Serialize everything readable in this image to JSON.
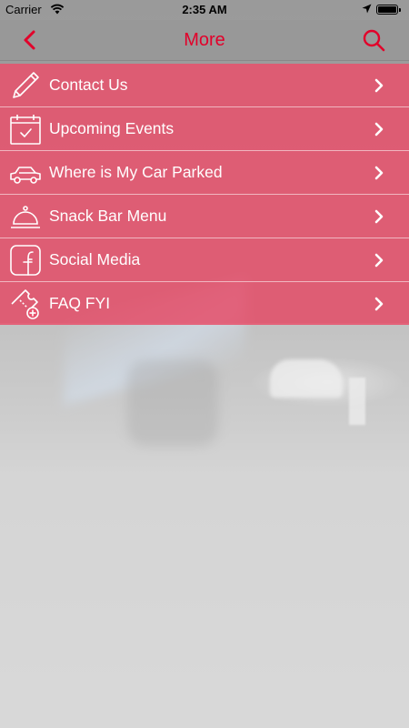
{
  "status_bar": {
    "carrier": "Carrier",
    "time": "2:35 AM"
  },
  "nav": {
    "title": "More",
    "back_icon": "chevron-left-icon",
    "search_icon": "search-icon",
    "accent_color": "#e2002a"
  },
  "menu": {
    "background_color": "#e8526c",
    "items": [
      {
        "label": "Contact Us",
        "icon": "pencil-icon"
      },
      {
        "label": "Upcoming Events",
        "icon": "calendar-check-icon"
      },
      {
        "label": "Where is My Car Parked",
        "icon": "car-icon"
      },
      {
        "label": "Snack Bar Menu",
        "icon": "food-cloche-icon"
      },
      {
        "label": "Social Media",
        "icon": "facebook-icon"
      },
      {
        "label": "FAQ FYI",
        "icon": "ticket-add-icon"
      }
    ]
  }
}
